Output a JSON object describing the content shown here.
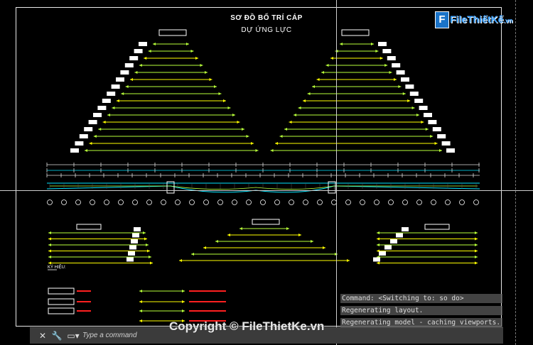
{
  "drawing": {
    "title_line1": "SƠ ĐỒ BỐ TRÍ CÁP",
    "title_line2": "DỰ ỨNG LỰC",
    "colors": {
      "bar_green": "#b8ff3a",
      "bar_yellow": "#ffff00",
      "label_white": "#ffffff",
      "red_text": "#ff2020",
      "cyan": "#00e5ff",
      "box_border": "#ffffff"
    },
    "legend_heading": "KÝ HIỆU:"
  },
  "logo": {
    "text": "FileThiếtKế",
    "suffix": ".vn"
  },
  "command_history": [
    "Command:   <Switching to: so do>",
    "Regenerating layout.",
    "Regenerating model - caching viewports."
  ],
  "command_bar": {
    "close_icon": "close-icon",
    "settings_icon": "wrench-icon",
    "placeholder": "Type a command"
  },
  "watermark": "Copyright © FileThietKe.vn"
}
